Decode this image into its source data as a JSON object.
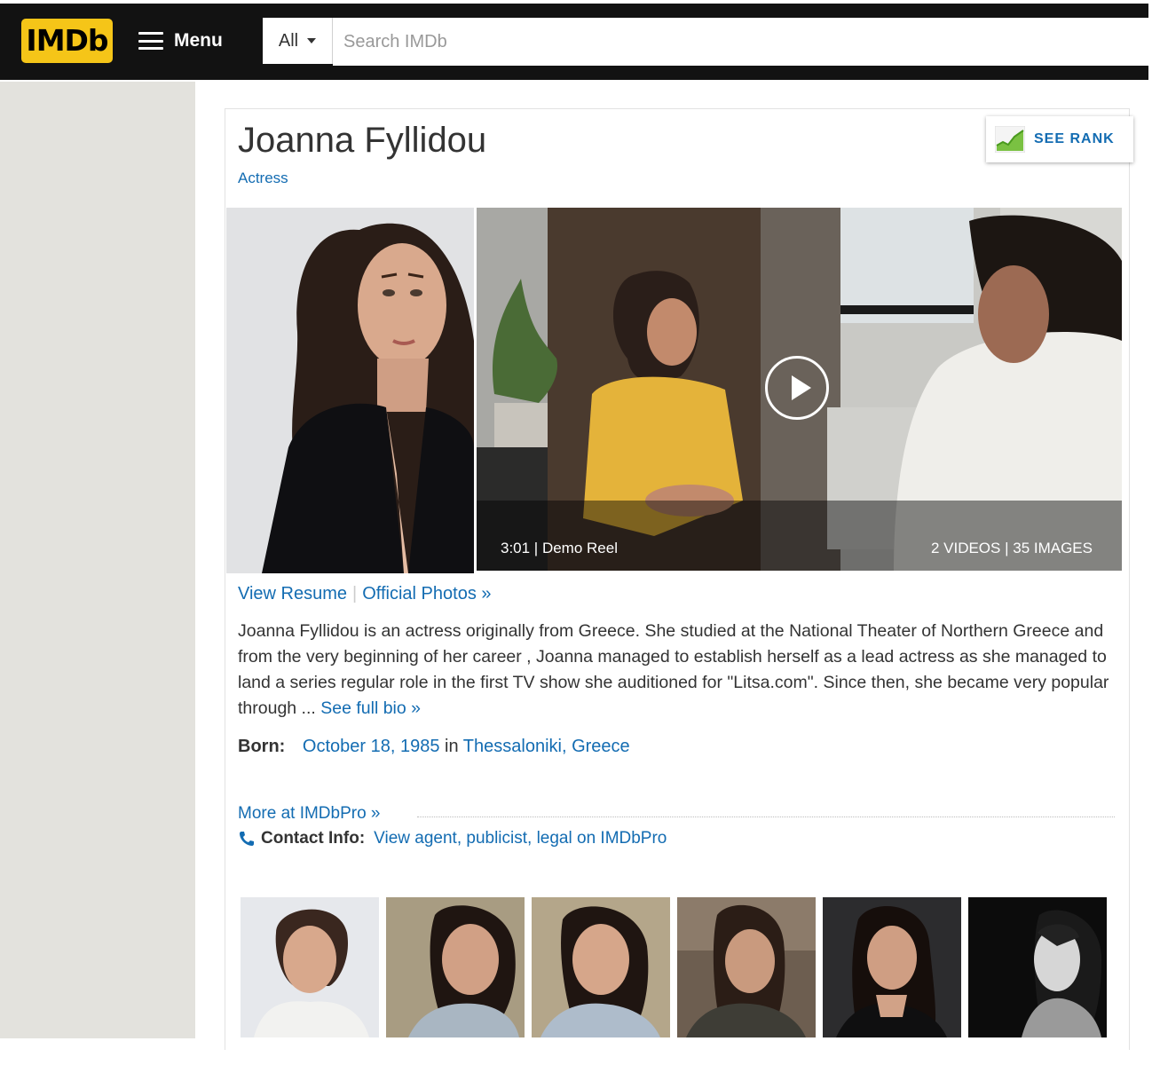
{
  "header": {
    "logo_text": "IMDb",
    "menu_label": "Menu",
    "search_category": "All",
    "search_placeholder": "Search IMDb"
  },
  "profile": {
    "name": "Joanna Fyllidou",
    "role": "Actress",
    "see_rank_label": "SEE RANK"
  },
  "media": {
    "video_caption": "3:01 | Demo Reel",
    "media_count": "2 VIDEOS | 35 IMAGES"
  },
  "links": {
    "view_resume": "View Resume",
    "separator": "|",
    "official_photos": "Official Photos »"
  },
  "bio": {
    "text": "Joanna Fyllidou is an actress originally from Greece. She studied at the National Theater of Northern Greece and from the very beginning of her career , Joanna managed to establish herself as a lead actress as she managed to land a series regular role in the first TV show she auditioned for \"Litsa.com\". Since then, she became very popular through ...",
    "see_full_bio": "See full bio »"
  },
  "born": {
    "label": "Born:",
    "date": "October 18, 1985",
    "in_word": "in",
    "place": "Thessaloniki, Greece"
  },
  "imdbpro": {
    "more_label": "More at IMDbPro »",
    "contact_label": "Contact Info:",
    "contact_link": "View agent, publicist, legal on IMDbPro"
  },
  "colors": {
    "imdb_yellow": "#f5c518",
    "link_blue": "#136cb2",
    "header_black": "#121212"
  }
}
